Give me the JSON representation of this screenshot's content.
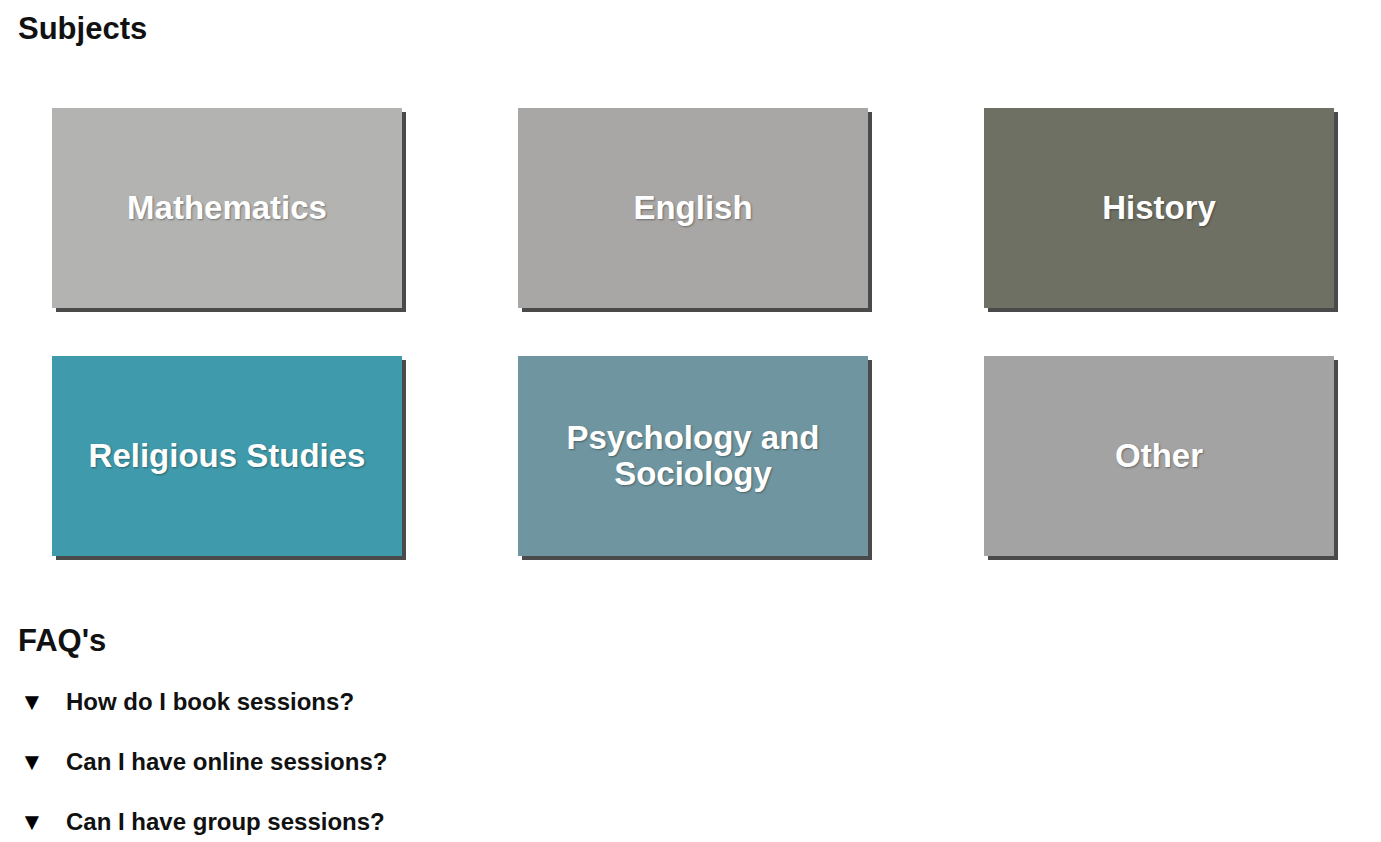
{
  "subjects_section": {
    "title": "Subjects"
  },
  "subjects": [
    {
      "label": "Mathematics",
      "color": "#b3b3b1"
    },
    {
      "label": "English",
      "color": "#a9a7a5"
    },
    {
      "label": "History",
      "color": "#6f7064"
    },
    {
      "label": "Religious Studies",
      "color": "#3f9aab"
    },
    {
      "label": "Psychology and Sociology",
      "color": "#6f96a0"
    },
    {
      "label": "Other",
      "color": "#a3a3a3"
    }
  ],
  "faq_section": {
    "title": "FAQ's"
  },
  "faqs": [
    {
      "icon": "▼",
      "question": "How do I book sessions?"
    },
    {
      "icon": "▼",
      "question": "Can I have online sessions?"
    },
    {
      "icon": "▼",
      "question": "Can I have group sessions?"
    }
  ]
}
